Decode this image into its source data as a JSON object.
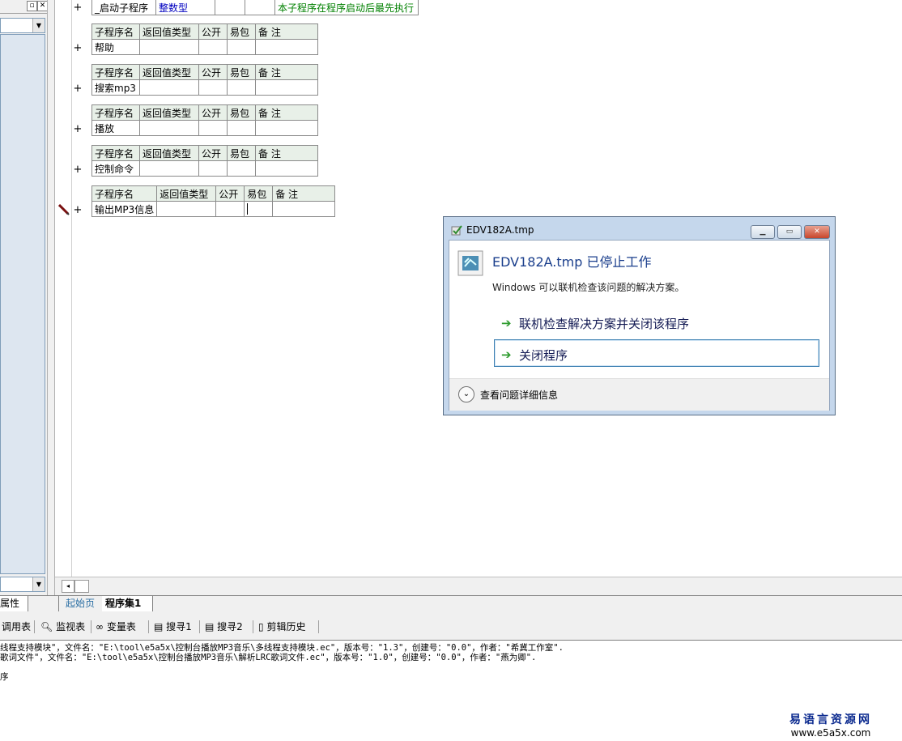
{
  "left_panel": {
    "tab_label": "属性"
  },
  "editor": {
    "first_row": {
      "name": "_启动子程序",
      "return_type": "整数型",
      "public": "",
      "easy_pkg": "",
      "remark": "本子程序在程序启动后最先执行"
    },
    "headers": [
      "子程序名",
      "返回值类型",
      "公开",
      "易包",
      "备 注"
    ],
    "subroutines": [
      {
        "name": "帮助"
      },
      {
        "name": "搜索mp3"
      },
      {
        "name": "播放"
      },
      {
        "name": "控制命令"
      },
      {
        "name": "输出MP3信息"
      }
    ],
    "plus_sign": "+"
  },
  "dialog": {
    "title": "EDV182A.tmp",
    "heading": "EDV182A.tmp 已停止工作",
    "description": "Windows 可以联机检查该问题的解决方案。",
    "option1": "联机检查解决方案并关闭该程序",
    "option2": "关闭程序",
    "details": "查看问题详细信息",
    "arrow_glyph": "➔",
    "minimize": "▁",
    "restore": "▭",
    "close": "✕"
  },
  "tabs": {
    "start_page": "起始页",
    "program_set": "程序集1"
  },
  "toolbar": {
    "call_table": "调用表",
    "watch_table": "监视表",
    "var_table": "变量表",
    "search1": "搜寻1",
    "search2": "搜寻2",
    "clip_history": "剪辑历史"
  },
  "output": {
    "line1": "线程支持模块\"，文件名：\"E:\\tool\\e5a5x\\控制台播放MP3音乐\\多线程支持模块.ec\"，版本号：\"1.3\"，创建号：\"0.0\"，作者：\"希冀工作室\".",
    "line2": "歌词文件\"，文件名：\"E:\\tool\\e5a5x\\控制台播放MP3音乐\\解析LRC歌词文件.ec\"，版本号：\"1.0\"，创建号：\"0.0\"，作者：\"燕为卿\".",
    "line3": "序"
  },
  "watermark": {
    "line1": "易语言资源网",
    "line2": "www.e5a5x.com"
  },
  "colors": {
    "dialog_frame": "#c5d7ec",
    "link_text": "#151c55",
    "arrow": "#2d9b2d"
  }
}
